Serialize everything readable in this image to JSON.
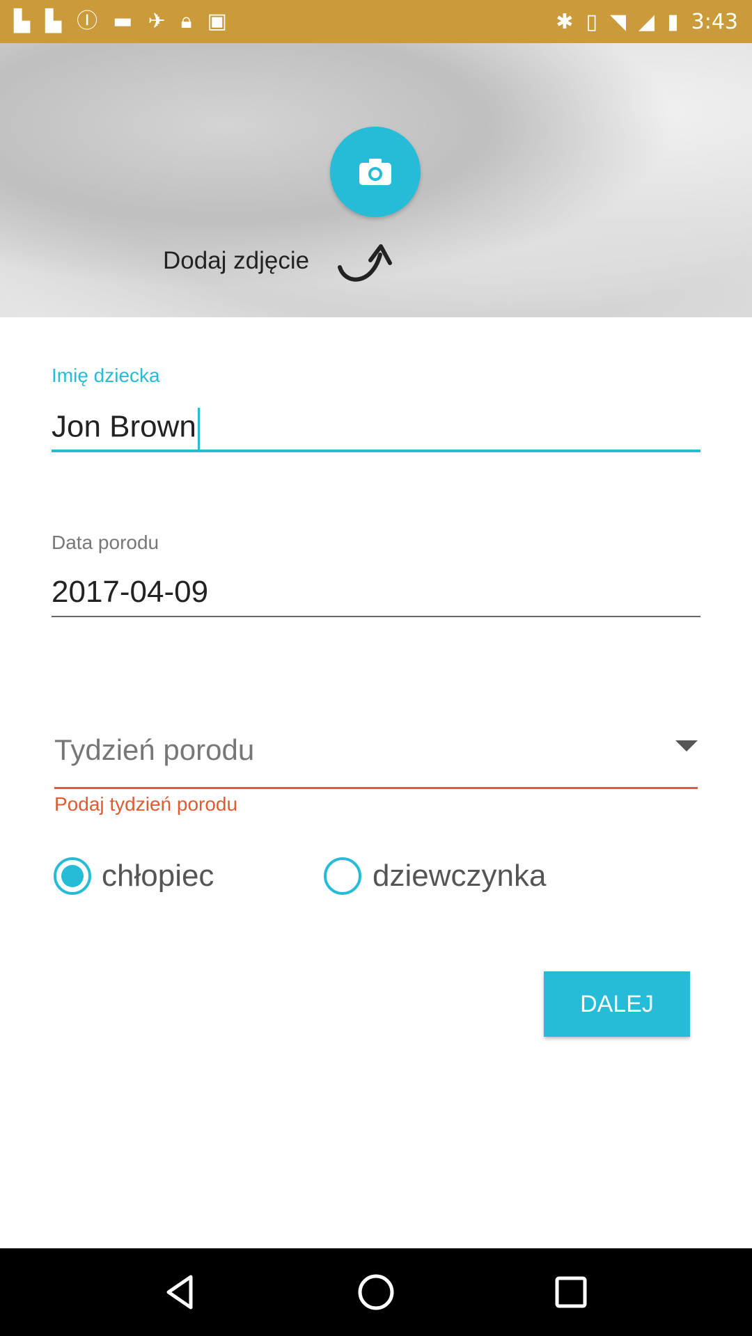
{
  "status_bar": {
    "time": "3:43",
    "left_icons": [
      "flipboard-icon",
      "flipboard-icon",
      "signal-icon",
      "media-icon",
      "satellite-icon",
      "lock-icon",
      "android-icon"
    ],
    "right_icons": [
      "bluetooth-icon",
      "vibrate-icon",
      "wifi-icon",
      "signal-icon",
      "battery-icon"
    ],
    "bar_color": "#ca9a3b"
  },
  "header": {
    "add_photo_label": "Dodaj zdjęcie"
  },
  "form": {
    "name": {
      "label": "Imię dziecka",
      "value": "Jon Brown"
    },
    "birth_date": {
      "label": "Data porodu",
      "value": "2017-04-09"
    },
    "birth_week": {
      "placeholder": "Tydzień porodu",
      "error": "Podaj tydzień porodu"
    },
    "gender": {
      "options": [
        {
          "label": "chłopiec",
          "selected": true
        },
        {
          "label": "dziewczynka",
          "selected": false
        }
      ]
    },
    "next_label": "DALEJ"
  },
  "colors": {
    "accent": "#26bcd7",
    "error": "#e05a33"
  }
}
